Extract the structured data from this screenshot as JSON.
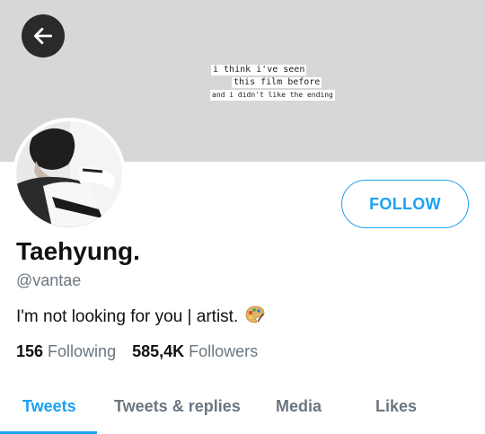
{
  "banner": {
    "quote_lines": [
      "i think i've seen",
      "this film before",
      "and i didn't like the ending"
    ]
  },
  "profile": {
    "name": "Taehyung.",
    "handle": "@vantae",
    "bio": "I'm not looking for you | artist.",
    "bio_emoji_icon": "artist-palette-icon"
  },
  "actions": {
    "follow_label": "FOLLOW"
  },
  "stats": {
    "following_count": "156",
    "following_label": "Following",
    "followers_count": "585,4K",
    "followers_label": "Followers"
  },
  "tabs": [
    {
      "label": "Tweets",
      "active": true
    },
    {
      "label": "Tweets & replies",
      "active": false
    },
    {
      "label": "Media",
      "active": false
    },
    {
      "label": "Likes",
      "active": false
    }
  ],
  "colors": {
    "accent": "#1da1f2",
    "banner": "#d9d6d8",
    "muted_text": "#6b7680"
  }
}
